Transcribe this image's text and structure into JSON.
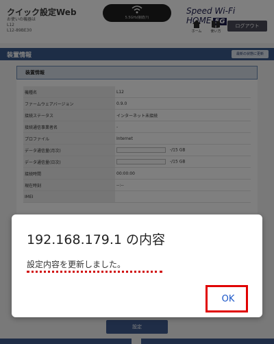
{
  "header": {
    "app_title": "クイック設定Web",
    "device_line1": "お使いの機器は",
    "device_line2": "L12",
    "device_line3": "L12-89BE30",
    "status_text": "5.5GHz接続(?)",
    "brand": "Speed Wi-Fi HOME",
    "brand_badge": "5G",
    "home_label": "ホーム",
    "manual_label": "使い方",
    "logout_label": "ログアウト"
  },
  "section": {
    "title": "装置情報",
    "update_label": "最新の状態に更新"
  },
  "panel": {
    "header": "装置情報",
    "rows": [
      {
        "key": "機種名",
        "value": "L12"
      },
      {
        "key": "ファームウェアバージョン",
        "value": "0.9.0"
      },
      {
        "key": "接続ステータス",
        "value": "インターネット未接続"
      },
      {
        "key": "接続通信事業者名",
        "value": "-"
      },
      {
        "key": "プロファイル",
        "value": "Internet"
      },
      {
        "key": "データ通信量(月次)",
        "value": "-/15 GB"
      },
      {
        "key": "データ通信量(日次)",
        "value": "-/15 GB"
      },
      {
        "key": "接続時間",
        "value": "00:00:00"
      },
      {
        "key": "現在時刻",
        "value": "--:--"
      },
      {
        "key": "IMEI",
        "value": ""
      }
    ]
  },
  "setting_label": "設定",
  "dialog": {
    "title": "192.168.179.1 の内容",
    "message": "設定内容を更新しました。",
    "ok_label": "OK"
  },
  "colors": {
    "accent": "#3e5b8f",
    "annotation": "#e00000",
    "ok_text": "#1a56c8"
  }
}
